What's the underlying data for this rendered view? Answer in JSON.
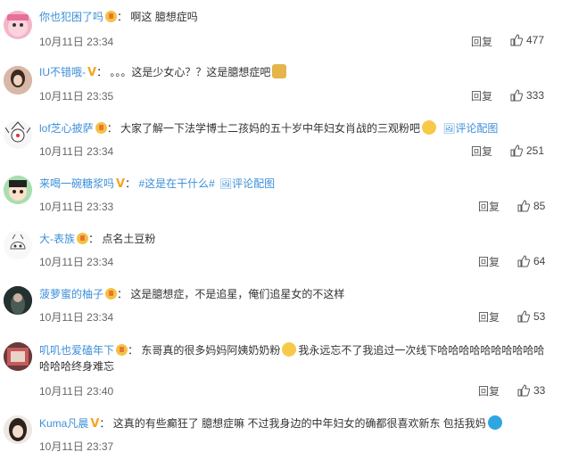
{
  "reply_label": "回复",
  "comments": [
    {
      "user": "你也犯困了吗",
      "text": "啊这 臆想症吗",
      "time": "10月11日 23:34",
      "likes": "477"
    },
    {
      "user": "IU不错哦-",
      "text": "。。。这是少女心？？这是臆想症吧",
      "time": "10月11日 23:35",
      "likes": "333"
    },
    {
      "user": "lof芝心披萨",
      "text": "大家了解一下法学博士二孩妈的五十岁中年妇女肖战的三观粉吧",
      "link": "评论配图",
      "time": "10月11日 23:34",
      "likes": "251"
    },
    {
      "user": "来喝一碗糖浆吗",
      "text": "#这是在干什么#",
      "link": "评论配图",
      "time": "10月11日 23:33",
      "likes": "85"
    },
    {
      "user": "大-表族",
      "text": "点名土豆粉",
      "time": "10月11日 23:34",
      "likes": "64"
    },
    {
      "user": "菠萝蜜的柚子",
      "text": "这是臆想症，不是追星，俺们追星女的不这样",
      "time": "10月11日 23:34",
      "likes": "53"
    },
    {
      "user": "叽叽也爱磕年下",
      "text_a": "东哥真的很多妈妈阿姨奶奶粉",
      "text_b": "我永远忘不了我追过一次线下哈哈哈哈哈哈哈哈哈哈哈哈哈终身难忘",
      "time": "10月11日 23:40",
      "likes": "33"
    },
    {
      "user": "Kuma凡晨",
      "text": "这真的有些癫狂了 臆想症嘛 不过我身边的中年妇女的确都很喜欢新东 包括我妈",
      "time": "10月11日 23:37"
    }
  ]
}
